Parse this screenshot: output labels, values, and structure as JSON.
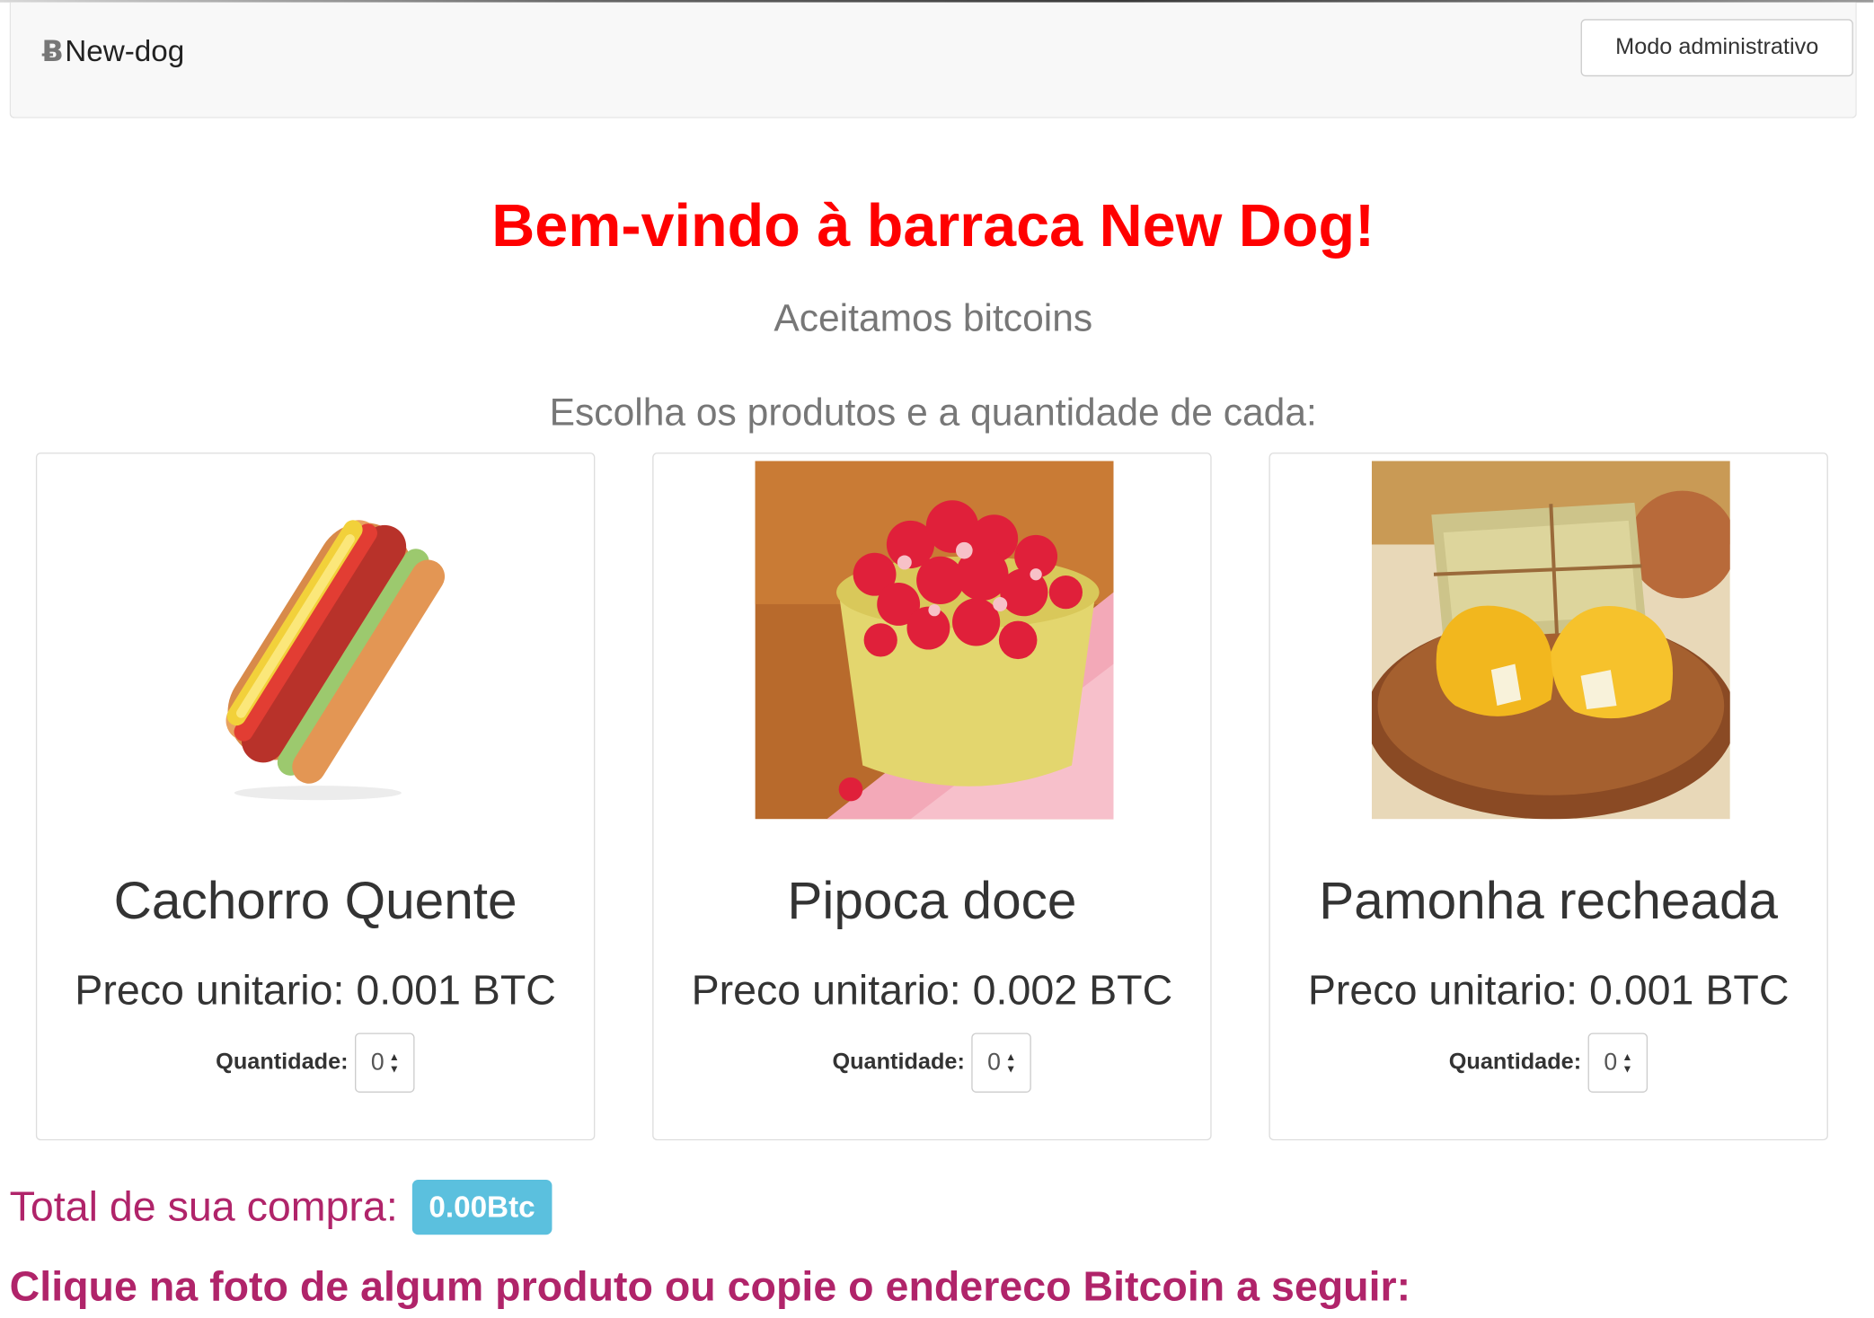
{
  "navbar": {
    "brand_icon": "Ƀ",
    "brand_name": "New-dog",
    "admin_button": "Modo administrativo"
  },
  "hero": {
    "title": "Bem-vindo à barraca New Dog!",
    "subtitle": "Aceitamos bitcoins",
    "instruction": "Escolha os produtos e a quantidade de cada:"
  },
  "products": [
    {
      "name": "Cachorro Quente",
      "price": "Preco unitario: 0.001 BTC",
      "qty_label": "Quantidade:",
      "qty": "0",
      "image": "hotdog-photo"
    },
    {
      "name": "Pipoca doce",
      "price": "Preco unitario: 0.002 BTC",
      "qty_label": "Quantidade:",
      "qty": "0",
      "image": "sweet-popcorn-photo"
    },
    {
      "name": "Pamonha recheada",
      "price": "Preco unitario: 0.001 BTC",
      "qty_label": "Quantidade:",
      "qty": "0",
      "image": "pamonha-photo"
    }
  ],
  "total": {
    "label": "Total de sua compra:",
    "value": "0.00Btc"
  },
  "instruction_pay": "Clique na foto de algum produto ou copie o endereco Bitcoin a seguir:",
  "colors": {
    "title": "#ff0000",
    "muted": "#777777",
    "accent": "#b0246a",
    "badge": "#5bc0de"
  }
}
